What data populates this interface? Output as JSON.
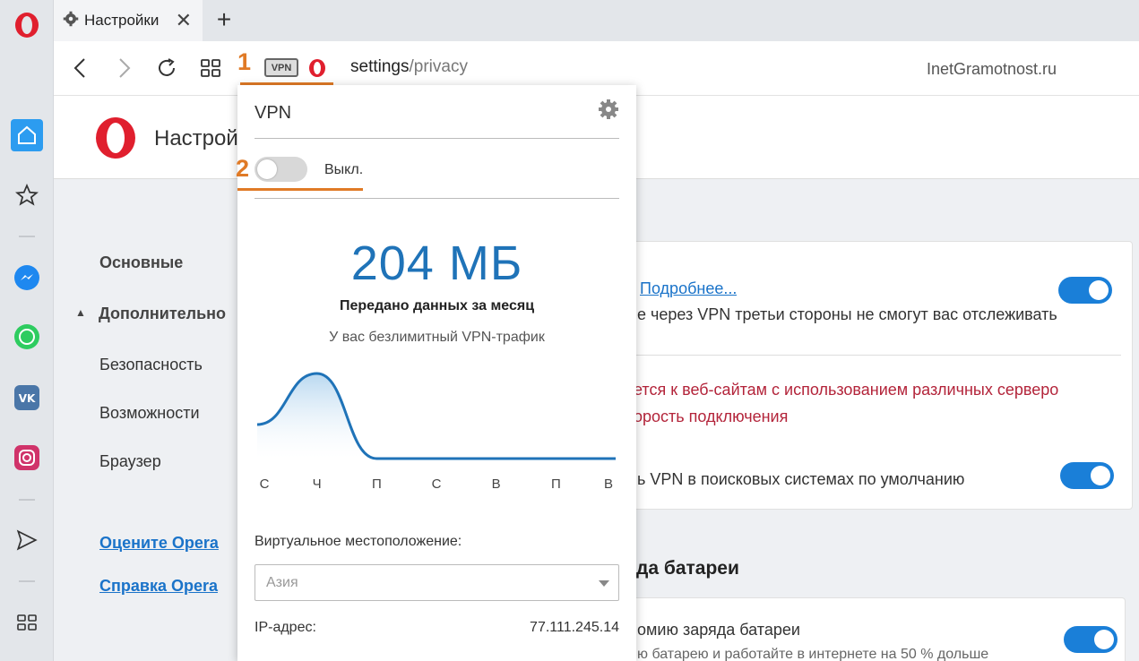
{
  "tab": {
    "title": "Настройки",
    "close": "✕",
    "new_tab": "+"
  },
  "address": {
    "annotation_1": "1",
    "vpn_badge": "VPN",
    "url_host": "settings",
    "url_path": "/privacy",
    "watermark": "InetGramotnost.ru"
  },
  "settings": {
    "title": "Настройки"
  },
  "left_nav": {
    "basic": "Основные",
    "advanced_arrow": "▲",
    "advanced": "Дополнительно",
    "security": "Безопасность",
    "features": "Возможности",
    "browser": "Браузер",
    "rate": "Оцените Opera",
    "help": "Справка Opera"
  },
  "cards": {
    "vpn_more_link": "Подробнее...",
    "vpn_desc": "е через VPN третьи стороны не смогут вас отслеживать",
    "vpn_warn_1": "ется к веб-сайтам с использованием различных серверо",
    "vpn_warn_2": "орость подключения",
    "vpn_search": "ь VPN в поисковых системах по умолчанию",
    "battery_title": "да батареи",
    "battery_item": "омию заряда батареи",
    "battery_desc": "ю батарею и работайте в интернете на 50 % дольше"
  },
  "vpn_popup": {
    "title": "VPN",
    "annotation_2": "2",
    "state": "Выкл.",
    "traffic": "204 МБ",
    "traffic_label": "Передано данных за месяц",
    "traffic_sub": "У вас безлимитный VPN-трафик",
    "location_label": "Виртуальное местоположение:",
    "location_value": "Азия",
    "ip_label": "IP-адрес:",
    "ip_value": "77.111.245.14"
  },
  "chart_data": {
    "type": "area",
    "categories": [
      "С",
      "Ч",
      "П",
      "С",
      "В",
      "П",
      "В"
    ],
    "values": [
      0.4,
      1.0,
      0.0,
      0.0,
      0.0,
      0.0,
      0.0
    ],
    "ylim": [
      0,
      1
    ],
    "grid": false,
    "legend": "none"
  },
  "colors": {
    "accent": "#1a7fd8",
    "annotation": "#e07a26",
    "warning": "#b3243a",
    "link": "#1a73c9"
  }
}
